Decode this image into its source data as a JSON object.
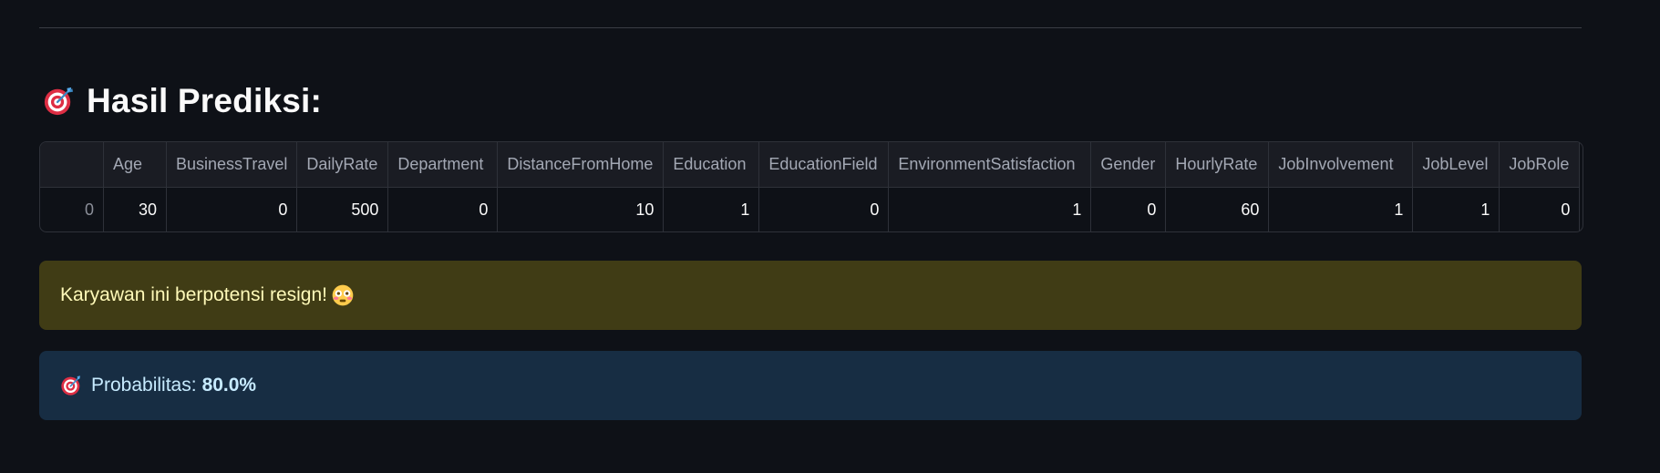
{
  "heading": {
    "icon": "target-icon",
    "title": "Hasil Prediksi:"
  },
  "table": {
    "columns": [
      "",
      "Age",
      "BusinessTravel",
      "DailyRate",
      "Department",
      "DistanceFromHome",
      "Education",
      "EducationField",
      "EnvironmentSatisfaction",
      "Gender",
      "HourlyRate",
      "JobInvolvement",
      "JobLevel",
      "JobRole"
    ],
    "rows": [
      [
        "0",
        "30",
        "0",
        "500",
        "0",
        "10",
        "1",
        "0",
        "1",
        "0",
        "60",
        "1",
        "1",
        "0"
      ]
    ]
  },
  "warning": {
    "text": "Karyawan ini berpotensi resign!",
    "icon": "flushed-face-icon",
    "background": "#403c15",
    "color": "#fffab9"
  },
  "info": {
    "icon": "target-icon",
    "label": "Probabilitas:",
    "value": "80.0%",
    "background": "#172d43",
    "color": "#c7ebff"
  }
}
